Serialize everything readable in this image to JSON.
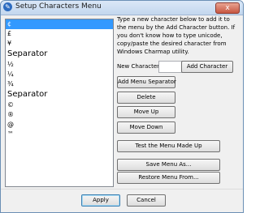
{
  "window": {
    "title": "Setup Characters Menu",
    "close_label": "x"
  },
  "list": {
    "items": [
      "¢",
      "£",
      "¥",
      "Separator",
      "½",
      "¼",
      "¾",
      "Separator",
      "©",
      "®",
      "@",
      "™"
    ],
    "selected_index": 0
  },
  "instructions": "Type a new character below to add it to the menu by the Add Character button. If you don't know how to type unicode, copy/paste the desired character from Windows Charmap utility.",
  "new_character": {
    "label": "New Character:",
    "value": ""
  },
  "buttons": {
    "add_character": "Add Character",
    "add_menu_separator": "Add Menu Separator",
    "delete": "Delete",
    "move_up": "Move Up",
    "move_down": "Move Down",
    "test_menu": "Test the Menu Made Up",
    "save_menu": "Save Menu As...",
    "restore_menu": "Restore Menu From...",
    "apply": "Apply",
    "cancel": "Cancel"
  }
}
